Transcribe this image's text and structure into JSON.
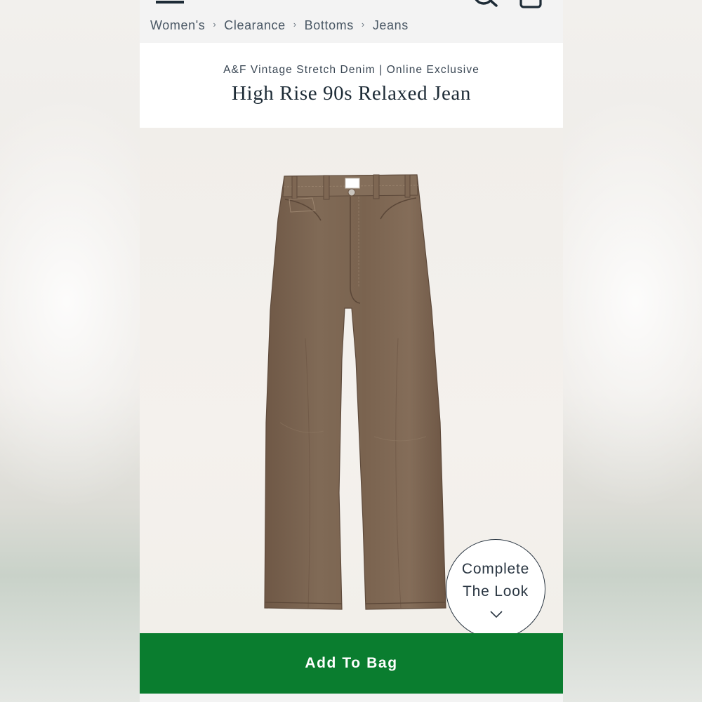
{
  "breadcrumb": {
    "items": [
      "Women's",
      "Clearance",
      "Bottoms",
      "Jeans"
    ],
    "separator": "›"
  },
  "product": {
    "collection": "A&F Vintage Stretch Denim | Online Exclusive",
    "title": "High Rise 90s Relaxed Jean",
    "image_subject": "brown relaxed jeans",
    "denim_color": "#7a634f"
  },
  "complete_look": {
    "line1": "Complete",
    "line2": "The Look"
  },
  "actions": {
    "add_to_bag_label": "Add To Bag",
    "add_to_bag_color": "#0a7d2f"
  },
  "icons": {
    "menu": "hamburger-menu-icon",
    "search": "search-icon",
    "bag": "shopping-bag-icon",
    "chevron": "chevron-down-icon"
  }
}
